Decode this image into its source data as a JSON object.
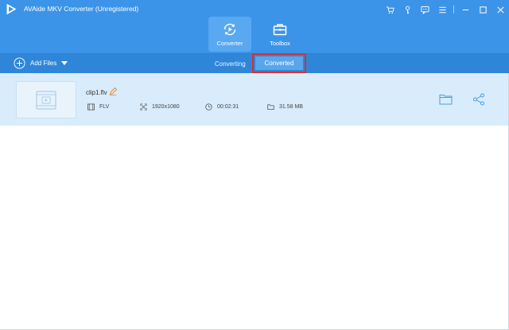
{
  "window": {
    "title": "AVAide MKV Converter (Unregistered)"
  },
  "nav": {
    "tabs": [
      {
        "label": "Converter",
        "active": true
      },
      {
        "label": "Toolbox",
        "active": false
      }
    ]
  },
  "toolbar": {
    "add_files_label": "Add Files",
    "subtabs": [
      {
        "label": "Converting",
        "active": false
      },
      {
        "label": "Converted",
        "active": true
      }
    ]
  },
  "files": [
    {
      "name": "clip1.flv",
      "format": "FLV",
      "resolution": "1920x1080",
      "duration": "00:02:31",
      "size": "31.58 MB"
    }
  ],
  "icons": {
    "window_controls": [
      "cart-icon",
      "key-icon",
      "feedback-icon",
      "menu-icon",
      "minimize-icon",
      "maximize-icon",
      "close-icon"
    ],
    "nav": [
      "converter-icon",
      "toolbox-icon"
    ],
    "file_row": [
      "video-thumbnail-icon",
      "edit-icon",
      "film-icon",
      "resolution-icon",
      "clock-icon",
      "folder-size-icon",
      "open-folder-icon",
      "share-icon"
    ]
  },
  "colors": {
    "header_blue": "#3c94e8",
    "toolbar_blue": "#2f86d9",
    "active_tab": "#58a8f2",
    "row_highlight": "#d9ecfb",
    "annotation_red": "#d63131"
  }
}
